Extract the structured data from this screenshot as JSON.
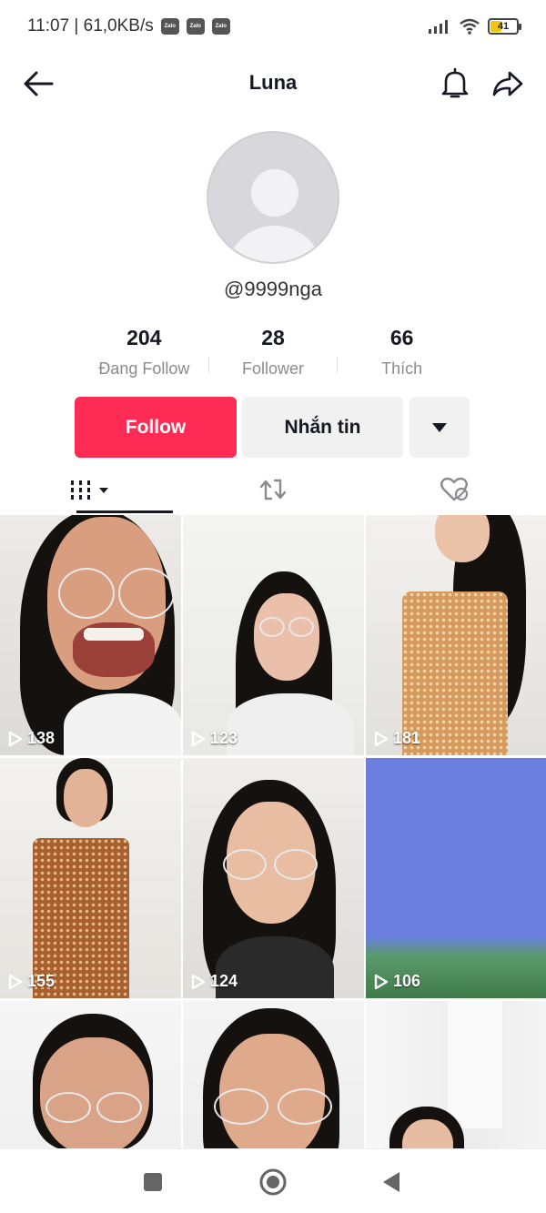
{
  "status_bar": {
    "time_speed": "11:07 | 61,0KB/s",
    "notification_icons": [
      "zalo",
      "zalo",
      "zalo"
    ],
    "zalo_label": "Zalo",
    "battery_level": "41",
    "battery_fraction": 0.41
  },
  "header": {
    "title": "Luna"
  },
  "profile": {
    "username": "@9999nga",
    "stats": [
      {
        "value": "204",
        "label": "Đang Follow"
      },
      {
        "value": "28",
        "label": "Follower"
      },
      {
        "value": "66",
        "label": "Thích"
      }
    ]
  },
  "actions": {
    "follow_label": "Follow",
    "message_label": "Nhắn tin"
  },
  "videos": [
    {
      "views": "138"
    },
    {
      "views": "123"
    },
    {
      "views": "181"
    },
    {
      "views": "155"
    },
    {
      "views": "124"
    },
    {
      "views": "106"
    },
    {
      "views": ""
    },
    {
      "views": ""
    },
    {
      "views": ""
    }
  ],
  "colors": {
    "accent": "#fe2c55",
    "button_gray": "#f1f1f2",
    "text_primary": "#161823",
    "text_secondary": "#8a8b91"
  }
}
